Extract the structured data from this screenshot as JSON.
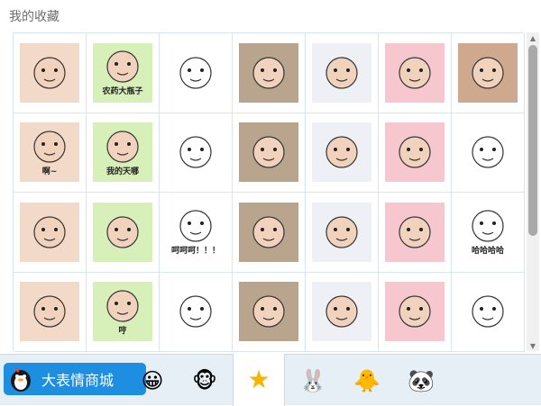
{
  "panel": {
    "title": "我的收藏"
  },
  "grid": {
    "items": [
      {
        "name": "sticker-girl-smiling",
        "label": ""
      },
      {
        "name": "sticker-bear-holding-bottle",
        "label": "农药大瓶子"
      },
      {
        "name": "sticker-smug-face",
        "label": ""
      },
      {
        "name": "sticker-cat-with-hat",
        "label": ""
      },
      {
        "name": "sticker-anime-girl-white-hair",
        "label": ""
      },
      {
        "name": "sticker-white-fox-sitting",
        "label": ""
      },
      {
        "name": "sticker-baby-crying",
        "label": ""
      },
      {
        "name": "sticker-ah-squiggle",
        "label": "啊~"
      },
      {
        "name": "sticker-crying-my-mom",
        "label": "我的天哪"
      },
      {
        "name": "sticker-shocked-cat",
        "label": ""
      },
      {
        "name": "sticker-girl-closeup",
        "label": ""
      },
      {
        "name": "sticker-tall-face-character",
        "label": ""
      },
      {
        "name": "sticker-boy-looking",
        "label": ""
      },
      {
        "name": "sticker-doubtful-face",
        "label": ""
      },
      {
        "name": "sticker-shocked-kid",
        "label": ""
      },
      {
        "name": "sticker-blank-stare-face",
        "label": ""
      },
      {
        "name": "sticker-panda-man-laughing",
        "label": "呵呵呵！！！"
      },
      {
        "name": "sticker-kid-in-cap",
        "label": ""
      },
      {
        "name": "sticker-red-haired-anime",
        "label": ""
      },
      {
        "name": "sticker-cat-man-face",
        "label": ""
      },
      {
        "name": "sticker-woman-laughing",
        "label": "哈哈哈哈"
      },
      {
        "name": "sticker-baby-face",
        "label": ""
      },
      {
        "name": "sticker-rabbit-hmph",
        "label": "哼"
      },
      {
        "name": "sticker-spotlight-figure",
        "label": ""
      },
      {
        "name": "sticker-half-face-peek",
        "label": ""
      },
      {
        "name": "sticker-boy-crying",
        "label": ""
      },
      {
        "name": "sticker-girl-in-car",
        "label": ""
      },
      {
        "name": "sticker-rabbit-sketch",
        "label": ""
      }
    ]
  },
  "bottom": {
    "mall_label": "大表情商城",
    "tabs": [
      {
        "name": "tab-emoji-smile",
        "glyph": "😀"
      },
      {
        "name": "tab-monkey",
        "glyph": "🐵"
      },
      {
        "name": "tab-favorites-star",
        "glyph": "★",
        "active": true
      },
      {
        "name": "tab-pink-character",
        "glyph": "🐰"
      },
      {
        "name": "tab-orange-character",
        "glyph": "🐥"
      },
      {
        "name": "tab-panda-character",
        "glyph": "🐼"
      }
    ]
  },
  "colors": {
    "accent": "#1e8fe0",
    "grid_border": "#d8e6f2",
    "bottom_bar": "#e6eef6",
    "star": "#f5b400"
  }
}
